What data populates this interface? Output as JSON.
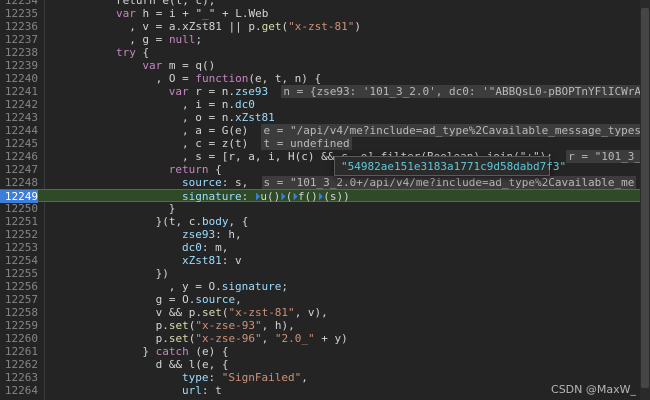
{
  "editor": {
    "lines": [
      {
        "no": "12234",
        "indent": 10,
        "segs": [
          [
            "plain",
            "return e(t, c),"
          ]
        ]
      },
      {
        "no": "12235",
        "indent": 10,
        "segs": [
          [
            "kw",
            "var"
          ],
          [
            "plain",
            " h = i + \""
          ],
          [
            "str",
            "_"
          ],
          [
            "plain",
            "\" + L.Web"
          ]
        ]
      },
      {
        "no": "12236",
        "indent": 12,
        "segs": [
          [
            "plain",
            ", v = a.xZst81 || p."
          ],
          [
            "fn",
            "get"
          ],
          [
            "plain",
            "("
          ],
          [
            "str",
            "\"x-zst-81\""
          ],
          [
            "plain",
            ")"
          ]
        ]
      },
      {
        "no": "12237",
        "indent": 12,
        "segs": [
          [
            "plain",
            ", g = "
          ],
          [
            "kw",
            "null"
          ],
          [
            "plain",
            ";"
          ]
        ]
      },
      {
        "no": "12238",
        "indent": 10,
        "segs": [
          [
            "kw",
            "try"
          ],
          [
            "plain",
            " {"
          ]
        ]
      },
      {
        "no": "12239",
        "indent": 14,
        "segs": [
          [
            "kw",
            "var"
          ],
          [
            "plain",
            " m = q()"
          ]
        ]
      },
      {
        "no": "12240",
        "indent": 16,
        "segs": [
          [
            "plain",
            ", O = "
          ],
          [
            "kw",
            "function"
          ],
          [
            "plain",
            "(e, t, n) {"
          ]
        ]
      },
      {
        "no": "12241",
        "indent": 18,
        "segs": [
          [
            "kw",
            "var"
          ],
          [
            "plain",
            " r = n."
          ],
          [
            "prop",
            "zse93"
          ]
        ],
        "inline": "n = {zse93: '101_3_2.0', dc0: '\"ABBQsL0-pBOPTnYFlICWrAs"
      },
      {
        "no": "12242",
        "indent": 20,
        "segs": [
          [
            "plain",
            ", i = n."
          ],
          [
            "prop",
            "dc0"
          ]
        ]
      },
      {
        "no": "12243",
        "indent": 20,
        "segs": [
          [
            "plain",
            ", o = n."
          ],
          [
            "prop",
            "xZst81"
          ]
        ]
      },
      {
        "no": "12244",
        "indent": 20,
        "segs": [
          [
            "plain",
            ", a = G(e)"
          ]
        ],
        "inline": "e = \"/api/v4/me?include=ad_type%2Cavailable_message_types%"
      },
      {
        "no": "12245",
        "indent": 20,
        "segs": [
          [
            "plain",
            ", c = z(t)"
          ]
        ],
        "inline": "t = undefined"
      },
      {
        "no": "12246",
        "indent": 20,
        "segs": [
          [
            "plain",
            ", s = [r, a, i, H(c) && c, o].filter(Boolean).join(\"+\");"
          ]
        ],
        "inline2": "r = \"101_3_2."
      },
      {
        "no": "12247",
        "indent": 18,
        "segs": [
          [
            "kw",
            "return"
          ],
          [
            "plain",
            " {"
          ]
        ]
      },
      {
        "no": "12248",
        "indent": 20,
        "segs": [
          [
            "prop",
            "source"
          ],
          [
            "plain",
            ": s,"
          ]
        ],
        "inline": "s = \"101_3_2.0+/api/v4/me?include=ad_type%2Cavailable_me"
      },
      {
        "no": "12249",
        "indent": 20,
        "paused": true,
        "segs": [
          [
            "prop",
            "signature"
          ],
          [
            "plain",
            ": "
          ],
          [
            "bp",
            "⏵"
          ],
          [
            "plain",
            "u()"
          ],
          [
            "bp",
            "⏵"
          ],
          [
            "plain",
            "("
          ],
          [
            "bp",
            "⏵"
          ],
          [
            "plain",
            "f()"
          ],
          [
            "bp",
            "⏵"
          ],
          [
            "plain",
            "(s))"
          ]
        ]
      },
      {
        "no": "12250",
        "indent": 18,
        "segs": [
          [
            "plain",
            "}"
          ]
        ]
      },
      {
        "no": "12251",
        "indent": 16,
        "segs": [
          [
            "plain",
            "}(t, c."
          ],
          [
            "prop",
            "body"
          ],
          [
            "plain",
            ", {"
          ]
        ]
      },
      {
        "no": "12252",
        "indent": 20,
        "segs": [
          [
            "prop",
            "zse93"
          ],
          [
            "plain",
            ": h,"
          ]
        ]
      },
      {
        "no": "12253",
        "indent": 20,
        "segs": [
          [
            "prop",
            "dc0"
          ],
          [
            "plain",
            ": m,"
          ]
        ]
      },
      {
        "no": "12254",
        "indent": 20,
        "segs": [
          [
            "prop",
            "xZst81"
          ],
          [
            "plain",
            ": v"
          ]
        ]
      },
      {
        "no": "12255",
        "indent": 16,
        "segs": [
          [
            "plain",
            "})"
          ]
        ]
      },
      {
        "no": "12256",
        "indent": 18,
        "segs": [
          [
            "plain",
            ", y = O."
          ],
          [
            "prop",
            "signature"
          ],
          [
            "plain",
            ";"
          ]
        ]
      },
      {
        "no": "12257",
        "indent": 16,
        "segs": [
          [
            "plain",
            "g = O."
          ],
          [
            "prop",
            "source"
          ],
          [
            "plain",
            ","
          ]
        ]
      },
      {
        "no": "12258",
        "indent": 16,
        "segs": [
          [
            "plain",
            "v && p."
          ],
          [
            "fn",
            "set"
          ],
          [
            "plain",
            "("
          ],
          [
            "str",
            "\"x-zst-81\""
          ],
          [
            "plain",
            ", v),"
          ]
        ]
      },
      {
        "no": "12259",
        "indent": 16,
        "segs": [
          [
            "plain",
            "p."
          ],
          [
            "fn",
            "set"
          ],
          [
            "plain",
            "("
          ],
          [
            "str",
            "\"x-zse-93\""
          ],
          [
            "plain",
            ", h),"
          ]
        ]
      },
      {
        "no": "12260",
        "indent": 16,
        "segs": [
          [
            "plain",
            "p."
          ],
          [
            "fn",
            "set"
          ],
          [
            "plain",
            "("
          ],
          [
            "str",
            "\"x-zse-96\""
          ],
          [
            "plain",
            ", "
          ],
          [
            "str",
            "\"2.0_\""
          ],
          [
            "plain",
            " + y)"
          ]
        ]
      },
      {
        "no": "12261",
        "indent": 14,
        "segs": [
          [
            "plain",
            "} "
          ],
          [
            "kw",
            "catch"
          ],
          [
            "plain",
            " (e) {"
          ]
        ]
      },
      {
        "no": "12262",
        "indent": 16,
        "segs": [
          [
            "plain",
            "d && l(e, {"
          ]
        ]
      },
      {
        "no": "12263",
        "indent": 20,
        "segs": [
          [
            "prop",
            "type"
          ],
          [
            "plain",
            ": "
          ],
          [
            "str",
            "\"SignFailed\""
          ],
          [
            "plain",
            ","
          ]
        ]
      },
      {
        "no": "12264",
        "indent": 20,
        "segs": [
          [
            "prop",
            "url"
          ],
          [
            "plain",
            ": t"
          ]
        ]
      }
    ]
  },
  "tooltip": {
    "value": "\"54982ae151e3183a1771c9d58dabd7f3\""
  },
  "watermark": {
    "text": "CSDN @MaxW_"
  },
  "colors": {
    "background": "#242424",
    "paused_line": "#2e4a26",
    "keyword": "#c586c0",
    "string": "#ce9178",
    "property": "#9cdcfe",
    "tooltip_text": "#5ec8d8"
  }
}
